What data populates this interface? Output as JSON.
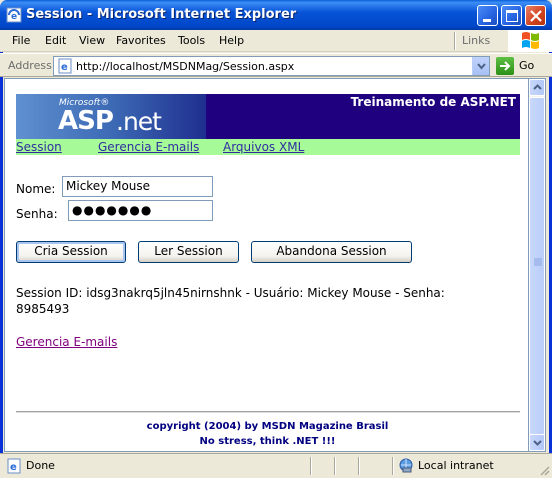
{
  "window": {
    "title": "Session - Microsoft Internet Explorer"
  },
  "menu": {
    "items": [
      "File",
      "Edit",
      "View",
      "Favorites",
      "Tools",
      "Help"
    ],
    "links_label": "Links"
  },
  "address": {
    "label": "Address",
    "url": "http://localhost/MSDNMag/Session.aspx",
    "go_label": "Go"
  },
  "page": {
    "banner": {
      "logo_small": "Microsoft®",
      "logo_asp": "ASP",
      "logo_net": ".net",
      "title": "Treinamento de ASP.NET"
    },
    "nav": [
      "Session",
      "Gerencia E-mails",
      "Arquivos XML"
    ],
    "form": {
      "name_label": "Nome:",
      "name_value": "Mickey Mouse",
      "password_label": "Senha:",
      "password_mask": "●●●●●●●"
    },
    "buttons": {
      "create": "Cria Session",
      "read": "Ler Session",
      "abandon": "Abandona Session"
    },
    "info_line1": "Session ID: idsg3nakrq5jln45nirnshnk - Usuário: Mickey Mouse - Senha:",
    "info_line2": "8985493",
    "bottom_link": "Gerencia E-mails",
    "footer_line1": "copyright (2004)  by MSDN Magazine Brasil",
    "footer_line2": "No stress, think .NET !!!"
  },
  "status": {
    "text": "Done",
    "zone": "Local intranet"
  },
  "colors": {
    "banner_bg": "#1f007f",
    "nav_bg": "#a6fb98",
    "nav_link": "#2f2fa0",
    "visited_link": "#800080",
    "footer_text": "#000080"
  }
}
